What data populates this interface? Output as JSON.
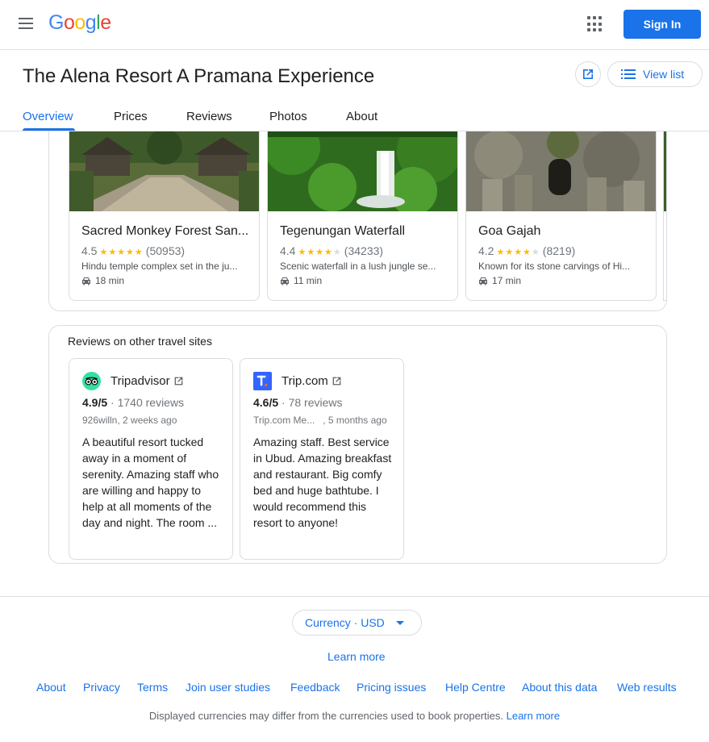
{
  "header": {
    "logo_letters": [
      "G",
      "o",
      "o",
      "g",
      "l",
      "e"
    ],
    "logo_colors": [
      "#4285f4",
      "#ea4335",
      "#fbbc05",
      "#4285f4",
      "#34a853",
      "#ea4335"
    ],
    "sign_in_label": "Sign In",
    "accent_color": "#1a73e8"
  },
  "hotel": {
    "title": "The Alena Resort A Pramana Experience",
    "view_list_label": "View list"
  },
  "tabs": [
    {
      "label": "Overview",
      "active": true
    },
    {
      "label": "Prices",
      "active": false
    },
    {
      "label": "Reviews",
      "active": false
    },
    {
      "label": "Photos",
      "active": false
    },
    {
      "label": "About",
      "active": false
    }
  ],
  "attractions": [
    {
      "name": "Sacred Monkey Forest San...",
      "rating": "4.5",
      "stars": 4.5,
      "count": "(50953)",
      "description": "Hindu temple complex set in the ju...",
      "travel_time": "18 min",
      "image_icon": "temple-image"
    },
    {
      "name": "Tegenungan Waterfall",
      "rating": "4.4",
      "stars": 4.4,
      "count": "(34233)",
      "description": "Scenic waterfall in a lush jungle se...",
      "travel_time": "11 min",
      "image_icon": "waterfall-image"
    },
    {
      "name": "Goa Gajah",
      "rating": "4.2",
      "stars": 4.2,
      "count": "(8219)",
      "description": "Known for its stone carvings of Hi...",
      "travel_time": "17 min",
      "image_icon": "cave-image"
    }
  ],
  "reviews_section": {
    "heading": "Reviews on other travel sites",
    "sites": [
      {
        "name": "Tripadvisor",
        "logo_icon": "tripadvisor-owl-icon",
        "logo_color": "#34e0a1",
        "score": "4.9/5",
        "reviews": " · 1740 reviews",
        "reviewer": "926willn, 2 weeks ago",
        "text": "A beautiful resort tucked away in a moment of serenity. Amazing staff who are willing and happy to help at all moments of the day and night. The room ..."
      },
      {
        "name": "Trip.com",
        "logo_icon": "tripcom-logo-icon",
        "logo_color": "#3264ff",
        "score": "4.6/5",
        "reviews": " · 78 reviews",
        "reviewer": "Trip.com Me...   , 5 months ago",
        "text": "Amazing staff. Best service in Ubud. Amazing breakfast and restaurant. Big comfy bed and huge bathtube. I would recommend this resort to anyone!"
      }
    ]
  },
  "footer": {
    "currency_label": "Currency · USD",
    "learn_more": "Learn more",
    "links": [
      "About",
      "Privacy",
      "Terms",
      "Join user studies",
      "Feedback",
      "Pricing issues",
      "Help Centre",
      "About this data",
      "Web results"
    ],
    "disclaimer": "Displayed currencies may differ from the currencies used to book properties.",
    "disclaimer_link": "Learn more"
  }
}
